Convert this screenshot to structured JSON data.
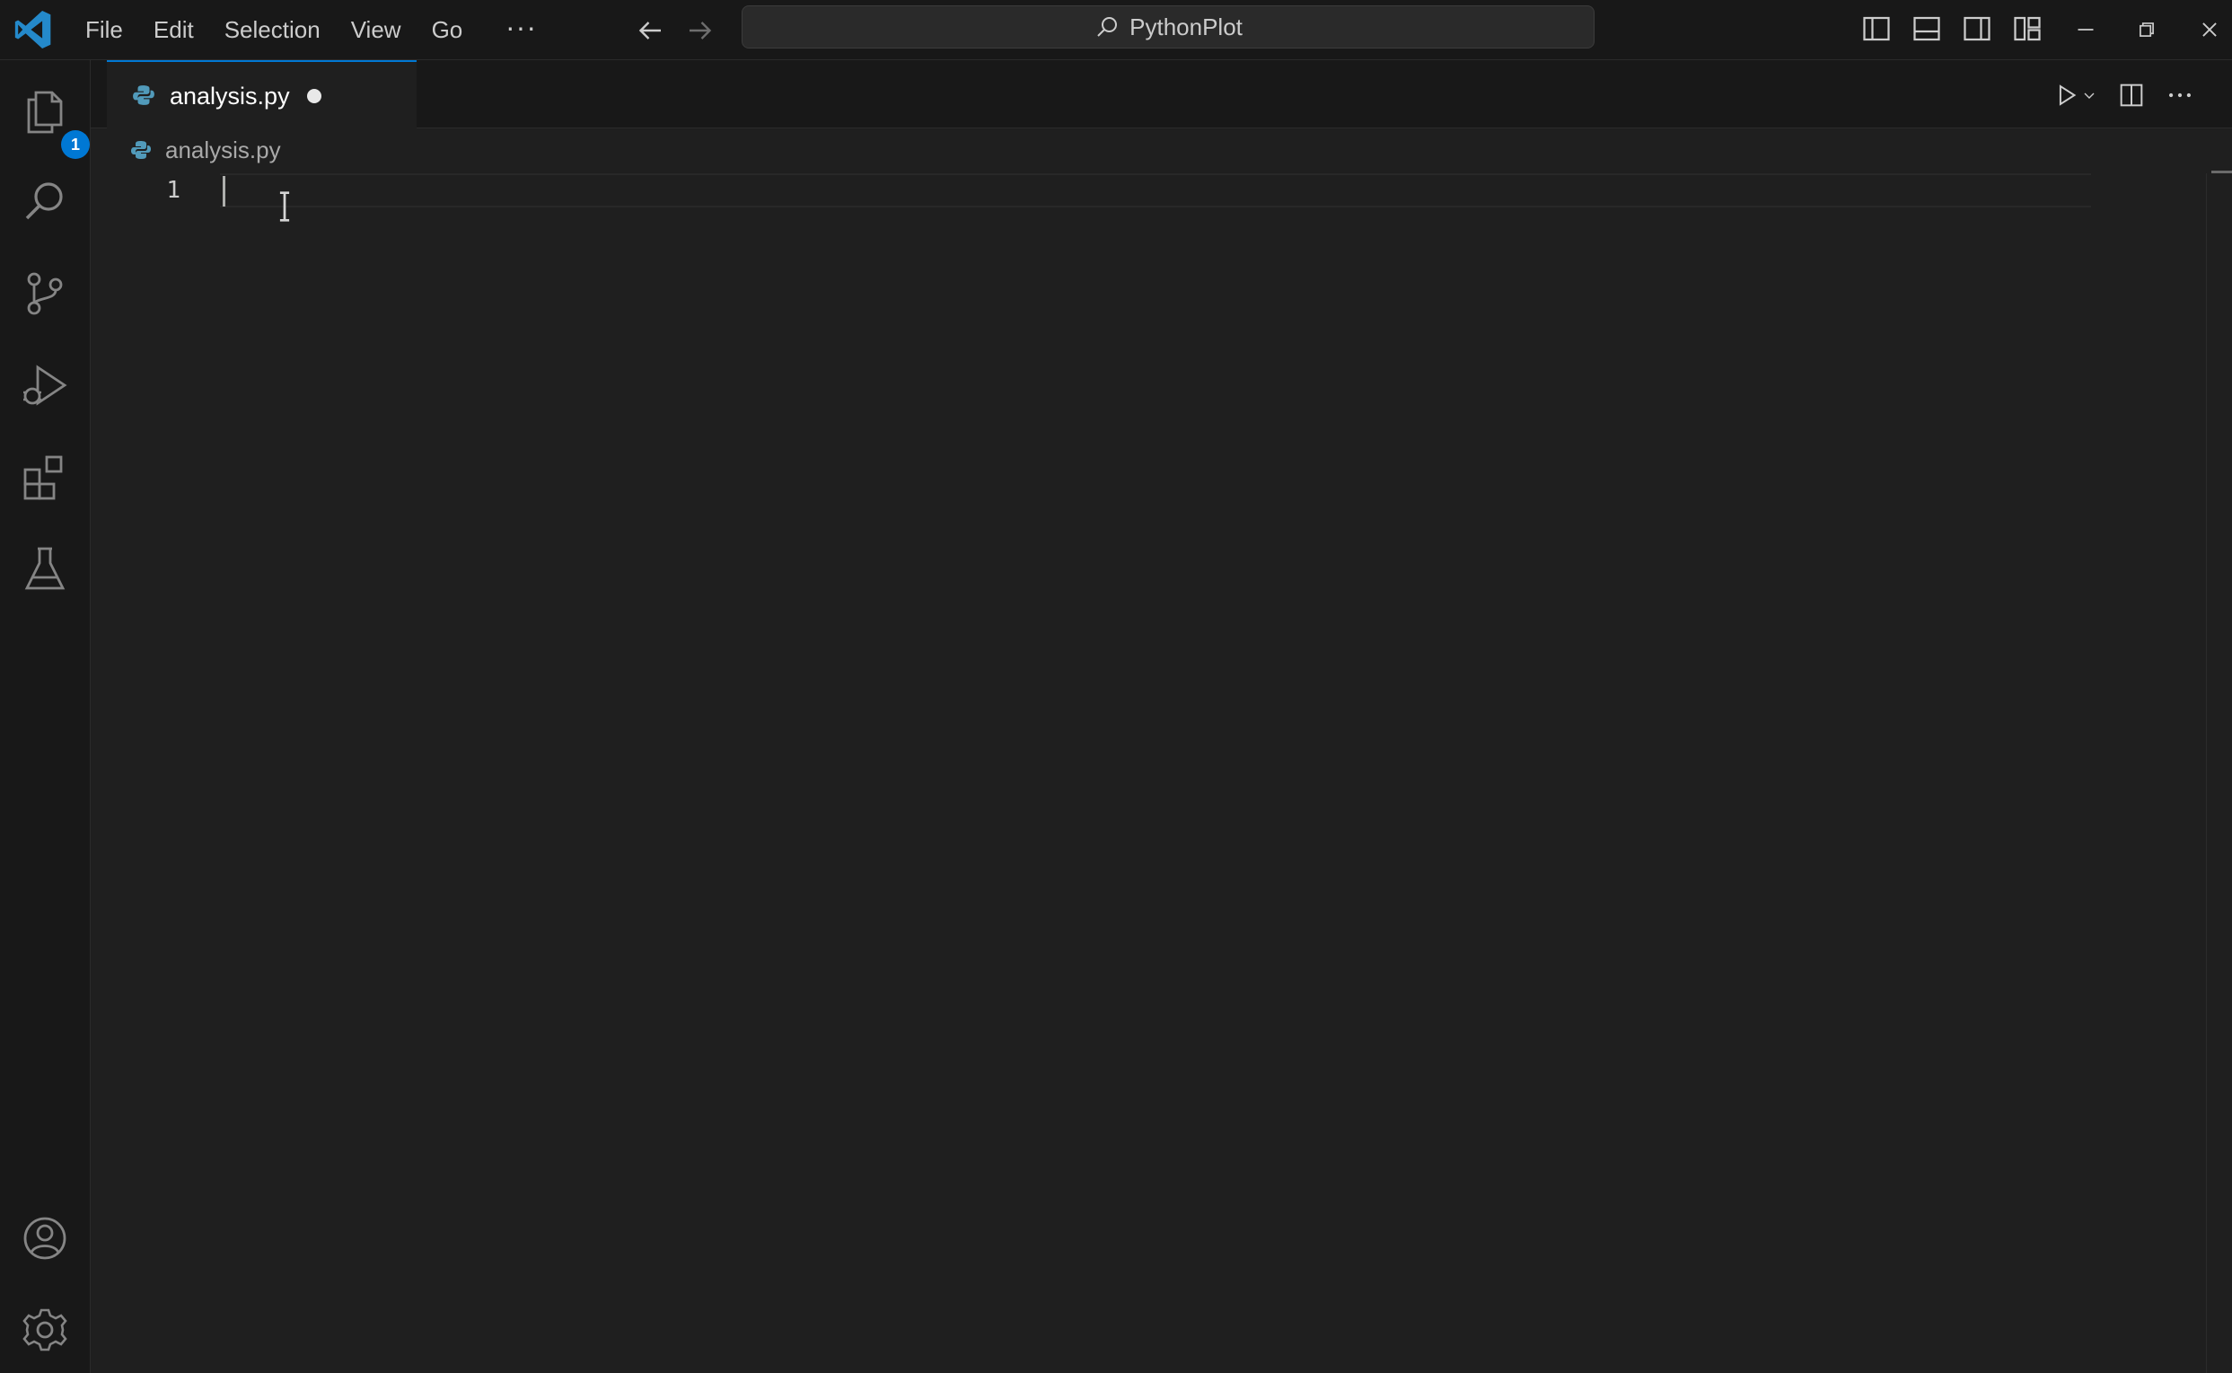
{
  "titlebar": {
    "menu": [
      "File",
      "Edit",
      "Selection",
      "View",
      "Go"
    ],
    "more": "···",
    "command_center": "PythonPlot"
  },
  "activity_bar": {
    "items": [
      "explorer-icon",
      "search-icon",
      "source-control-icon",
      "run-and-debug-icon",
      "extensions-icon",
      "testing-icon"
    ],
    "bottom": [
      "accounts-icon",
      "manage-gear-icon"
    ],
    "explorer_badge": "1"
  },
  "tabs": [
    {
      "label": "analysis.py",
      "dirty": true,
      "active": true
    }
  ],
  "breadcrumb": {
    "file": "analysis.py"
  },
  "editor": {
    "line_numbers": [
      "1"
    ],
    "lines": [
      ""
    ]
  },
  "colors": {
    "accent": "#0078d4",
    "editor_bg": "#1f1f1f",
    "chrome_bg": "#181818",
    "python_icon": "#519aba"
  }
}
